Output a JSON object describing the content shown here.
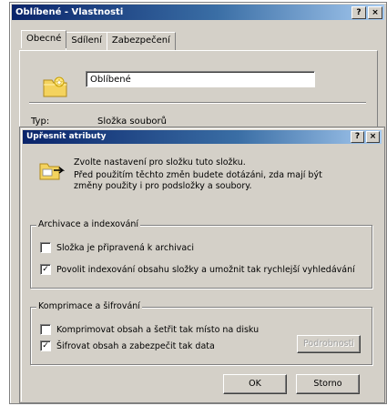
{
  "properties": {
    "title": "Oblíbené - Vlastnosti",
    "help_btn": "?",
    "close_btn": "×",
    "tabs": [
      {
        "label": "Obecné"
      },
      {
        "label": "Sdílení"
      },
      {
        "label": "Zabezpečení"
      }
    ],
    "name_value": "Oblíbené",
    "type_label": "Typ:",
    "type_value": "Složka souborů"
  },
  "advanced": {
    "title": "Upřesnit atributy",
    "help_btn": "?",
    "close_btn": "×",
    "intro_line1": "Zvolte nastavení pro složku tuto složku.",
    "intro_line2": "Před použitím těchto změn budete dotázáni, zda mají být změny použity i pro podsložky a soubory.",
    "archive_group": {
      "title": "Archivace a indexování",
      "items": [
        {
          "label": "Složka je připravená k archivaci",
          "checked": false,
          "mark": ""
        },
        {
          "label": "Povolit indexování obsahu složky a umožnit tak rychlejší vyhledávání",
          "checked": true,
          "mark": "✓"
        }
      ]
    },
    "compress_group": {
      "title": "Komprimace a šifrování",
      "items": [
        {
          "label": "Komprimovat obsah a šetřit tak místo na disku",
          "checked": false,
          "mark": ""
        },
        {
          "label": "Šifrovat obsah a zabezpečit tak data",
          "checked": true,
          "mark": "✓"
        }
      ],
      "details_label": "Podrobnosti"
    },
    "ok_label": "OK",
    "cancel_label": "Storno"
  }
}
